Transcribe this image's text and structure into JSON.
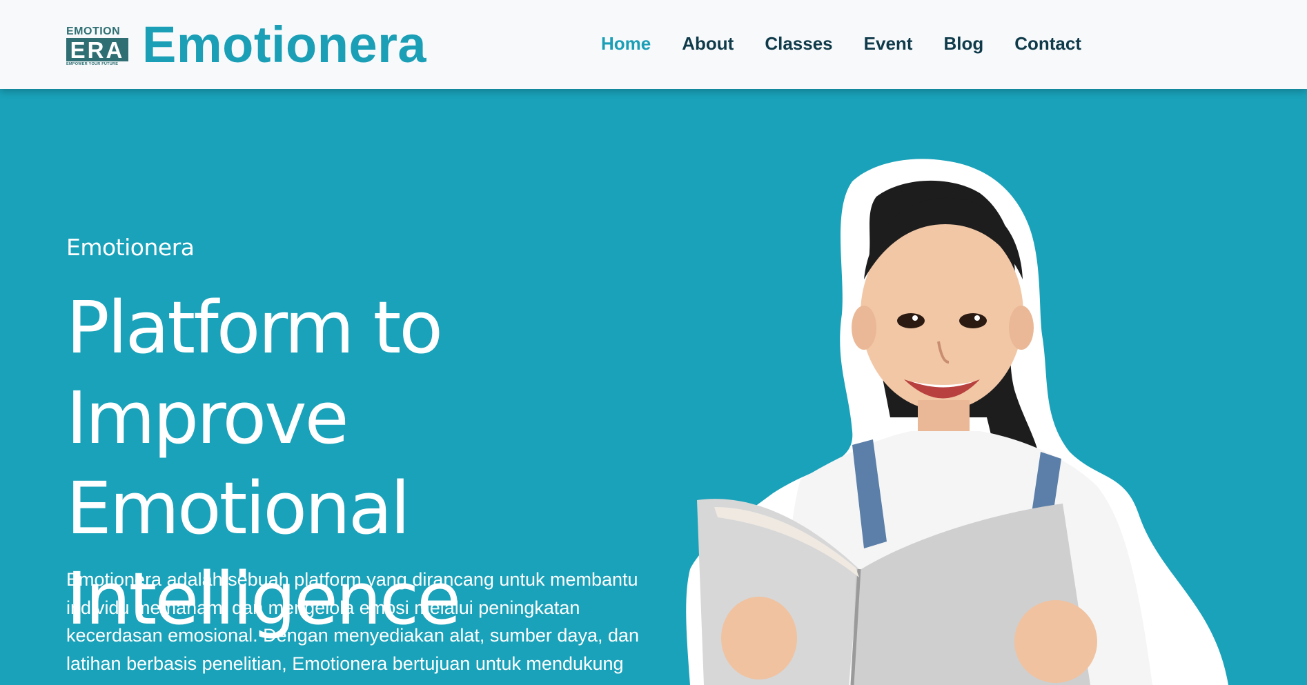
{
  "header": {
    "logo": {
      "top_text": "EMOTION",
      "main_text": "ERA",
      "tagline": "EMPOWER YOUR FUTURE"
    },
    "brand_name": "Emotionera",
    "nav": [
      {
        "label": "Home",
        "active": true
      },
      {
        "label": "About",
        "active": false
      },
      {
        "label": "Classes",
        "active": false
      },
      {
        "label": "Event",
        "active": false
      },
      {
        "label": "Blog",
        "active": false
      },
      {
        "label": "Contact",
        "active": false
      }
    ]
  },
  "hero": {
    "kicker": "Emotionera",
    "title_lines": [
      "Platform to",
      "Improve Emotional",
      "Intelligence"
    ],
    "description": "Emotionera adalah sebuah platform yang dirancang untuk membantu individu memahami dan mengelola emosi melalui peningkatan kecerdasan emosional. Dengan menyediakan alat, sumber daya, dan latihan berbasis penelitian, Emotionera bertujuan untuk mendukung",
    "image": "girl-reading-book-photo"
  },
  "colors": {
    "hero_background": "#19a2ba",
    "header_background": "#f7f9fb",
    "brand": "#1a9fb6",
    "nav_text": "#0f3a4a",
    "logo_dark": "#2f6f73"
  }
}
